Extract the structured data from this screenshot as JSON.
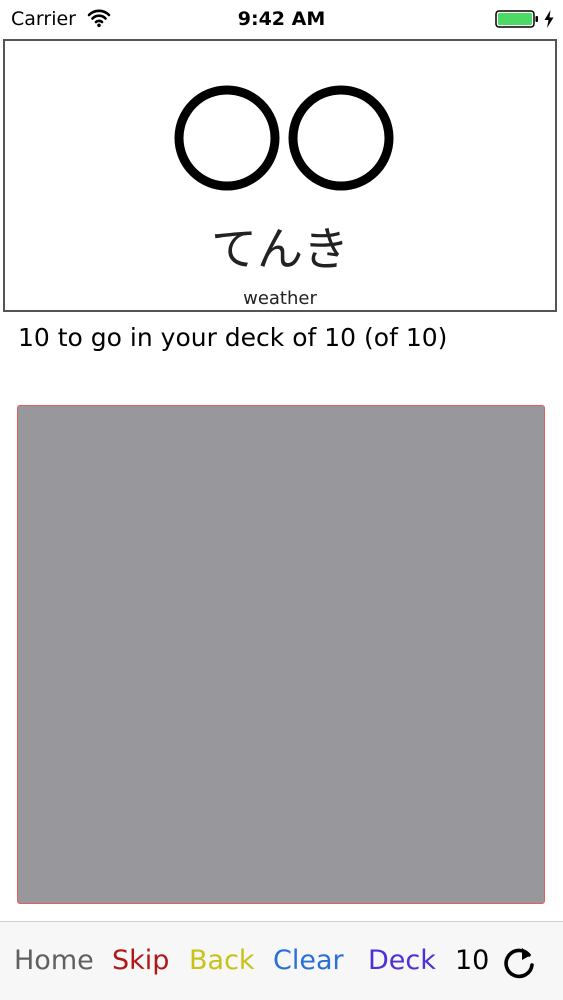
{
  "status_bar": {
    "carrier": "Carrier",
    "time": "9:42 AM",
    "wifi_icon": "wifi-icon",
    "battery_icon": "battery-icon",
    "charging_icon": "bolt-icon",
    "battery_color": "#4cd964"
  },
  "card": {
    "kanji_icon": "kanji-circles-art",
    "reading": "てんき",
    "meaning": "weather"
  },
  "progress": {
    "text": "10 to go in your deck of 10 (of 10)"
  },
  "canvas": {
    "background_color": "#98979b",
    "border_color": "#e06060"
  },
  "toolbar": {
    "home": "Home",
    "skip": "Skip",
    "back": "Back",
    "clear": "Clear",
    "deck": "Deck",
    "count": "10",
    "refresh_icon": "refresh-icon",
    "colors": {
      "home": "#606060",
      "skip": "#b01818",
      "back": "#c8c218",
      "clear": "#2a70d8",
      "deck": "#4f2fd8"
    }
  }
}
